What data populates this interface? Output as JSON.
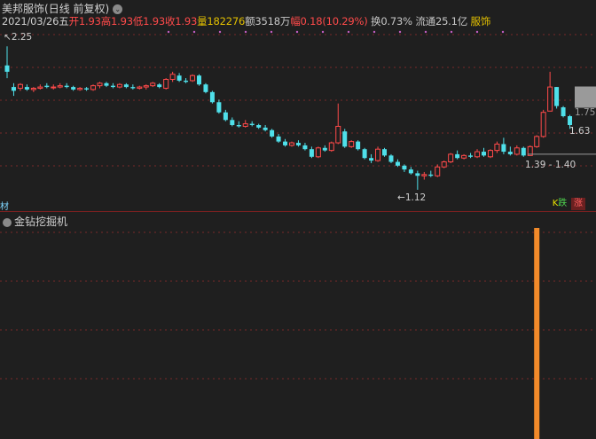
{
  "header": {
    "stock_name": "美邦服饰",
    "period": "(日线 前复权)",
    "date": "2021/03/26五",
    "open_label": "开",
    "open": "1.93",
    "high_label": "高",
    "high": "1.93",
    "low_label": "低",
    "low": "1.93",
    "close_label": "收",
    "close": "1.93",
    "vol_label": "量",
    "vol": "182276",
    "amount_label": "额",
    "amount": "3518万",
    "change_label": "幅",
    "change": "0.18(10.29%)",
    "turnover_label": "换",
    "turnover": "0.73%",
    "float_label": "流通",
    "float": "25.1亿",
    "sector": "服饰"
  },
  "price_chart": {
    "high_mark": "2.25",
    "low_mark": "1.12",
    "price_tag_top": "1.75",
    "price_tag_mid": "1.63",
    "range_label": "1.39 - 1.40",
    "side_tag": "材",
    "btn_k": "K跌",
    "btn_zhang": "涨"
  },
  "indicator": {
    "title": "金钻挖掘机"
  },
  "colors": {
    "up": "#ff4a4a",
    "down": "#4fe0ea",
    "bar": "#f28a2a",
    "grid": "#7a2a2a"
  },
  "chart_data": {
    "type": "candlestick",
    "ylim": [
      1.05,
      2.35
    ],
    "candles": [
      [
        2.1,
        2.25,
        2.0,
        2.05
      ],
      [
        1.93,
        1.96,
        1.86,
        1.9
      ],
      [
        1.92,
        1.96,
        1.9,
        1.95
      ],
      [
        1.93,
        1.95,
        1.9,
        1.91
      ],
      [
        1.91,
        1.93,
        1.89,
        1.92
      ],
      [
        1.92,
        1.95,
        1.91,
        1.93
      ],
      [
        1.94,
        1.96,
        1.92,
        1.93
      ],
      [
        1.93,
        1.95,
        1.91,
        1.93
      ],
      [
        1.93,
        1.96,
        1.92,
        1.94
      ],
      [
        1.94,
        1.96,
        1.92,
        1.93
      ],
      [
        1.93,
        1.94,
        1.9,
        1.91
      ],
      [
        1.91,
        1.93,
        1.9,
        1.92
      ],
      [
        1.92,
        1.93,
        1.9,
        1.91
      ],
      [
        1.91,
        1.95,
        1.9,
        1.94
      ],
      [
        1.94,
        1.97,
        1.92,
        1.96
      ],
      [
        1.96,
        1.97,
        1.93,
        1.94
      ],
      [
        1.94,
        1.96,
        1.92,
        1.93
      ],
      [
        1.93,
        1.96,
        1.92,
        1.95
      ],
      [
        1.95,
        1.96,
        1.92,
        1.93
      ],
      [
        1.93,
        1.95,
        1.91,
        1.92
      ],
      [
        1.92,
        1.94,
        1.91,
        1.93
      ],
      [
        1.93,
        1.95,
        1.91,
        1.94
      ],
      [
        1.94,
        1.97,
        1.93,
        1.96
      ],
      [
        1.95,
        1.96,
        1.92,
        1.93
      ],
      [
        1.92,
        2.0,
        1.91,
        1.99
      ],
      [
        1.99,
        2.05,
        1.97,
        2.03
      ],
      [
        2.02,
        2.04,
        1.97,
        1.98
      ],
      [
        1.98,
        2.0,
        1.96,
        1.97
      ],
      [
        1.98,
        2.03,
        1.97,
        2.02
      ],
      [
        2.02,
        2.03,
        1.94,
        1.95
      ],
      [
        1.95,
        1.96,
        1.88,
        1.89
      ],
      [
        1.89,
        1.9,
        1.8,
        1.81
      ],
      [
        1.81,
        1.83,
        1.72,
        1.73
      ],
      [
        1.73,
        1.75,
        1.66,
        1.67
      ],
      [
        1.67,
        1.69,
        1.62,
        1.63
      ],
      [
        1.63,
        1.66,
        1.61,
        1.62
      ],
      [
        1.62,
        1.67,
        1.61,
        1.64
      ],
      [
        1.64,
        1.66,
        1.62,
        1.63
      ],
      [
        1.63,
        1.64,
        1.6,
        1.61
      ],
      [
        1.61,
        1.63,
        1.58,
        1.59
      ],
      [
        1.59,
        1.6,
        1.53,
        1.54
      ],
      [
        1.54,
        1.56,
        1.49,
        1.5
      ],
      [
        1.5,
        1.52,
        1.46,
        1.47
      ],
      [
        1.47,
        1.5,
        1.46,
        1.49
      ],
      [
        1.49,
        1.51,
        1.46,
        1.47
      ],
      [
        1.47,
        1.49,
        1.43,
        1.44
      ],
      [
        1.44,
        1.46,
        1.37,
        1.38
      ],
      [
        1.38,
        1.46,
        1.37,
        1.45
      ],
      [
        1.45,
        1.47,
        1.42,
        1.43
      ],
      [
        1.43,
        1.5,
        1.42,
        1.49
      ],
      [
        1.49,
        1.8,
        1.48,
        1.62
      ],
      [
        1.58,
        1.6,
        1.45,
        1.46
      ],
      [
        1.46,
        1.51,
        1.45,
        1.5
      ],
      [
        1.5,
        1.51,
        1.43,
        1.44
      ],
      [
        1.44,
        1.45,
        1.36,
        1.37
      ],
      [
        1.37,
        1.4,
        1.33,
        1.35
      ],
      [
        1.35,
        1.46,
        1.34,
        1.44
      ],
      [
        1.44,
        1.45,
        1.38,
        1.39
      ],
      [
        1.39,
        1.4,
        1.33,
        1.34
      ],
      [
        1.34,
        1.36,
        1.3,
        1.31
      ],
      [
        1.31,
        1.32,
        1.26,
        1.28
      ],
      [
        1.28,
        1.3,
        1.24,
        1.25
      ],
      [
        1.25,
        1.27,
        1.12,
        1.23
      ],
      [
        1.23,
        1.26,
        1.2,
        1.24
      ],
      [
        1.24,
        1.27,
        1.22,
        1.23
      ],
      [
        1.23,
        1.32,
        1.22,
        1.3
      ],
      [
        1.3,
        1.35,
        1.29,
        1.34
      ],
      [
        1.34,
        1.41,
        1.33,
        1.4
      ],
      [
        1.4,
        1.43,
        1.36,
        1.37
      ],
      [
        1.37,
        1.4,
        1.36,
        1.39
      ],
      [
        1.39,
        1.41,
        1.37,
        1.38
      ],
      [
        1.38,
        1.44,
        1.37,
        1.42
      ],
      [
        1.42,
        1.45,
        1.38,
        1.39
      ],
      [
        1.38,
        1.44,
        1.37,
        1.43
      ],
      [
        1.43,
        1.5,
        1.41,
        1.48
      ],
      [
        1.48,
        1.53,
        1.4,
        1.42
      ],
      [
        1.42,
        1.46,
        1.39,
        1.4
      ],
      [
        1.4,
        1.47,
        1.39,
        1.45
      ],
      [
        1.45,
        1.46,
        1.38,
        1.39
      ],
      [
        1.39,
        1.47,
        1.39,
        1.46
      ],
      [
        1.46,
        1.55,
        1.45,
        1.54
      ],
      [
        1.54,
        1.75,
        1.53,
        1.73
      ],
      [
        1.74,
        2.05,
        1.74,
        1.93
      ],
      [
        1.93,
        1.93,
        1.76,
        1.78
      ],
      [
        1.77,
        1.78,
        1.69,
        1.7
      ],
      [
        1.7,
        1.71,
        1.6,
        1.63
      ]
    ],
    "indicator_signal_index": 80,
    "indicator_signal_value": 1
  }
}
